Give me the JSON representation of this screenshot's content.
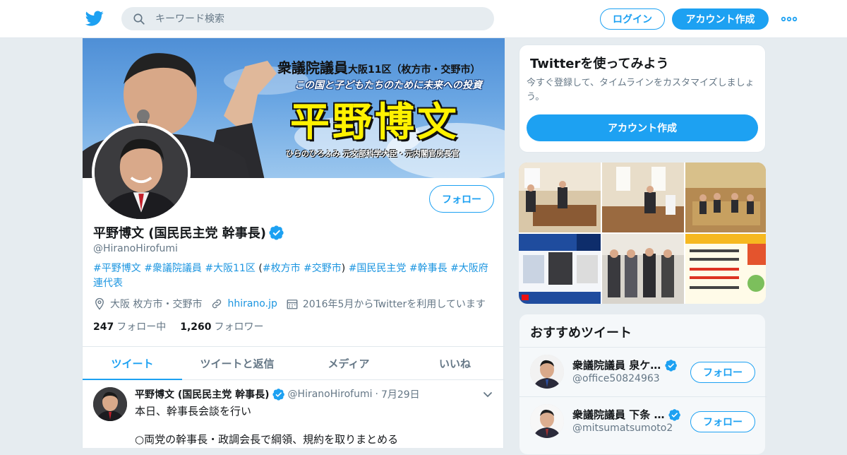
{
  "header": {
    "search_placeholder": "キーワード検索",
    "login_label": "ログイン",
    "signup_label": "アカウント作成"
  },
  "banner": {
    "line1": "衆議院議員",
    "line1_small": "大阪11区（枚方市・交野市）",
    "line2": "この国と子どもたちのために未来への投資",
    "name": "平野博文",
    "sub": "ひらのひろふみ 元文部科学大臣・元内閣官房長官"
  },
  "profile": {
    "follow_label": "フォロー",
    "name": "平野博文 (国民民主党 幹事長)",
    "handle": "@HiranoHirofumi",
    "bio": [
      {
        "text": "#平野博文",
        "tag": true
      },
      {
        "text": " ",
        "tag": false
      },
      {
        "text": "#衆議院議員",
        "tag": true
      },
      {
        "text": " ",
        "tag": false
      },
      {
        "text": "#大阪11区",
        "tag": true
      },
      {
        "text": " (",
        "tag": false
      },
      {
        "text": "#枚方市",
        "tag": true
      },
      {
        "text": " ",
        "tag": false
      },
      {
        "text": "#交野市",
        "tag": true
      },
      {
        "text": ") ",
        "tag": false
      },
      {
        "text": "#国民民主党",
        "tag": true
      },
      {
        "text": " ",
        "tag": false
      },
      {
        "text": "#幹事長",
        "tag": true
      },
      {
        "text": " ",
        "tag": false
      },
      {
        "text": "#大阪府連代表",
        "tag": true
      }
    ],
    "location": "大阪 枚方市・交野市",
    "website": "hhirano.jp",
    "joined": "2016年5月からTwitterを利用しています",
    "following_count": "247",
    "following_label": "フォロー中",
    "followers_count": "1,260",
    "followers_label": "フォロワー"
  },
  "tabs": [
    "ツイート",
    "ツイートと返信",
    "メディア",
    "いいね"
  ],
  "tweet": {
    "name": "平野博文 (国民民主党 幹事長)",
    "handle": "@HiranoHirofumi",
    "date": "7月29日",
    "body": "本日、幹事長会談を行い\n\n○両党の幹事長・政調会長で綱領、規約を取りまとめる"
  },
  "side": {
    "title": "Twitterを使ってみよう",
    "desc": "今すぐ登録して、タイムラインをカスタマイズしましょう。",
    "button": "アカウント作成"
  },
  "recommended": {
    "title": "おすすめツイート",
    "items": [
      {
        "name": "衆議院議員 泉ケ…",
        "handle": "@office50824963",
        "follow": "フォロー"
      },
      {
        "name": "衆議院議員 下条 …",
        "handle": "@mitsumatsumoto2",
        "follow": "フォロー"
      }
    ]
  },
  "colors": {
    "accent": "#1da1f2",
    "link": "#1b95e0",
    "muted": "#657786",
    "background": "#e6ecf0"
  }
}
